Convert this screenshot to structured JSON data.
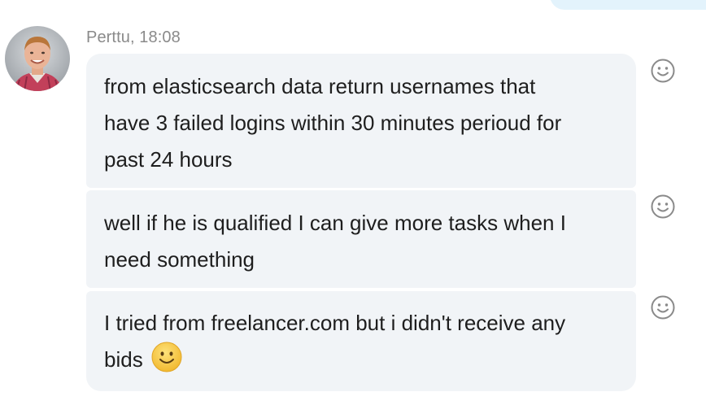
{
  "sender": {
    "name": "Perttu",
    "time": "18:08",
    "meta": "Perttu, 18:08",
    "avatar_icon": "user-avatar-photo"
  },
  "messages": [
    {
      "lines": [
        "from elasticsearch data return usernames that",
        "have 3 failed logins within 30 minutes perioud for",
        "past 24 hours"
      ],
      "reaction_icon": "smiley-outline-icon"
    },
    {
      "lines": [
        "well if he is qualified I can give more tasks when I",
        "need something"
      ],
      "reaction_icon": "smiley-outline-icon"
    },
    {
      "lines": [
        "I tried from freelancer.com but i didn't receive any",
        "bids"
      ],
      "inline_emoji": "smiley-face-emoji",
      "reaction_icon": "smiley-outline-icon"
    }
  ],
  "colors": {
    "bubble_bg": "#f1f4f7",
    "text": "#1e1e1e",
    "meta_text": "#8a8a8a",
    "own_bubble_bg": "#e3f3fc",
    "emoji_yellow": "#f7c948",
    "icon_gray": "#8a8a8a"
  }
}
